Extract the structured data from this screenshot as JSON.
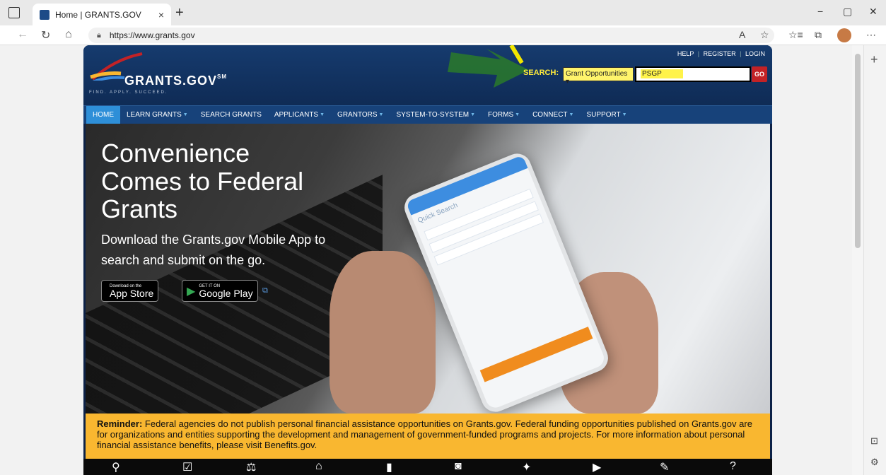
{
  "browser": {
    "tab_title": "Home | GRANTS.GOV",
    "tab_close": "×",
    "new_tab": "+",
    "url": "https://www.grants.gov",
    "min": "−",
    "max": "▢",
    "close": "✕",
    "back": "←",
    "reload": "↻",
    "home": "⌂",
    "read_aloud": "A",
    "favorite": "☆",
    "favorites": "☆≡",
    "collections": "⧉",
    "menu": "⋯",
    "side_plus": "+"
  },
  "header": {
    "toplinks": [
      "HELP",
      "REGISTER",
      "LOGIN"
    ],
    "logo_text": "GRANTS.GOV",
    "logo_sm": "SM",
    "tagline": "FIND. APPLY. SUCCEED.",
    "search_label": "SEARCH:",
    "search_select": "Grant Opportunities ▾",
    "search_value": "PSGP",
    "go_label": "GO"
  },
  "nav": {
    "items": [
      {
        "label": "HOME",
        "active": true,
        "caret": false
      },
      {
        "label": "LEARN GRANTS",
        "caret": true
      },
      {
        "label": "SEARCH GRANTS",
        "caret": false
      },
      {
        "label": "APPLICANTS",
        "caret": true
      },
      {
        "label": "GRANTORS",
        "caret": true
      },
      {
        "label": "SYSTEM-TO-SYSTEM",
        "caret": true
      },
      {
        "label": "FORMS",
        "caret": true
      },
      {
        "label": "CONNECT",
        "caret": true
      },
      {
        "label": "SUPPORT",
        "caret": true
      }
    ]
  },
  "hero": {
    "title": "Convenience Comes to Federal Grants",
    "subtitle": "Download the Grants.gov Mobile App to search and submit on the go.",
    "appstore_small": "Download on the",
    "appstore_big": "App Store",
    "googleplay_small": "GET IT ON",
    "googleplay_big": "Google Play",
    "phone_quick_search": "Quick Search"
  },
  "reminder": {
    "lead": "Reminder:",
    "text": " Federal agencies do not publish personal financial assistance opportunities on Grants.gov. Federal funding opportunities published on Grants.gov are for organizations and entities supporting the development and management of government-funded programs and projects. For more information about personal financial assistance benefits, please visit Benefits.gov."
  },
  "colors": {
    "brand_navy": "#0f2b55",
    "nav_active": "#2e8fd8",
    "reminder_bg": "#f9b730",
    "go_red": "#c32226",
    "search_highlight": "#fff46b"
  }
}
